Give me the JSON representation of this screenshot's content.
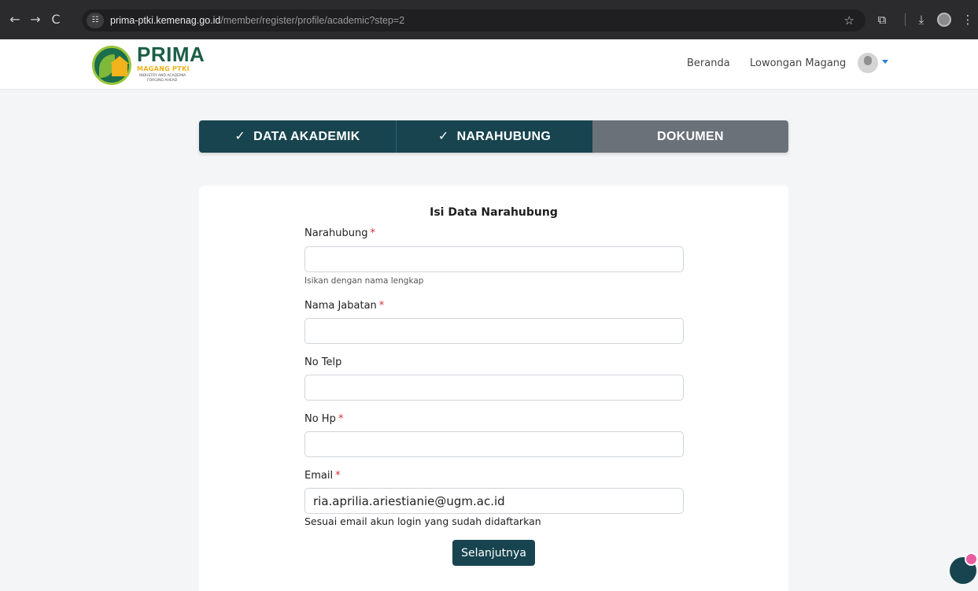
{
  "browser": {
    "url_host": "prima-ptki.kemenag.go.id",
    "url_path": "/member/register/profile/academic?step=2",
    "back_icon": "←",
    "forward_icon": "→",
    "reload_icon": "C",
    "site_info_icon": "☷",
    "star_icon": "☆",
    "extensions_icon": "⧉",
    "download_icon": "⤓",
    "menu_icon": "⋮"
  },
  "header": {
    "logo_title": "PRIMA",
    "logo_subtitle": "MAGANG PTKI",
    "logo_tagline_1": "INDUSTRY AND ACADEMIA",
    "logo_tagline_2": "FORGING AHEAD",
    "nav": [
      "Beranda",
      "Lowongan Magang"
    ]
  },
  "stepper": {
    "check_icon": "✓",
    "steps": [
      {
        "label": "DATA AKADEMIK",
        "state": "done"
      },
      {
        "label": "NARAHUBUNG",
        "state": "done"
      },
      {
        "label": "DOKUMEN",
        "state": "todo"
      }
    ]
  },
  "form": {
    "title": "Isi Data Narahubung",
    "required_mark": "*",
    "fields": [
      {
        "label": "Narahubung",
        "required": true,
        "value": "",
        "help": "Isikan dengan nama lengkap"
      },
      {
        "label": "Nama Jabatan",
        "required": true,
        "value": ""
      },
      {
        "label": "No Telp",
        "required": false,
        "value": ""
      },
      {
        "label": "No Hp",
        "required": true,
        "value": ""
      },
      {
        "label": "Email",
        "required": true,
        "value": "ria.aprilia.ariestianie@ugm.ac.id",
        "help": "Sesuai email akun login yang sudah didaftarkan"
      }
    ],
    "submit_label": "Selanjutnya"
  },
  "colors": {
    "primary": "#17444f",
    "step_inactive": "#6b7179",
    "required": "#d93030",
    "brand_green": "#1b5e46",
    "brand_yellow": "#f2b21b"
  }
}
